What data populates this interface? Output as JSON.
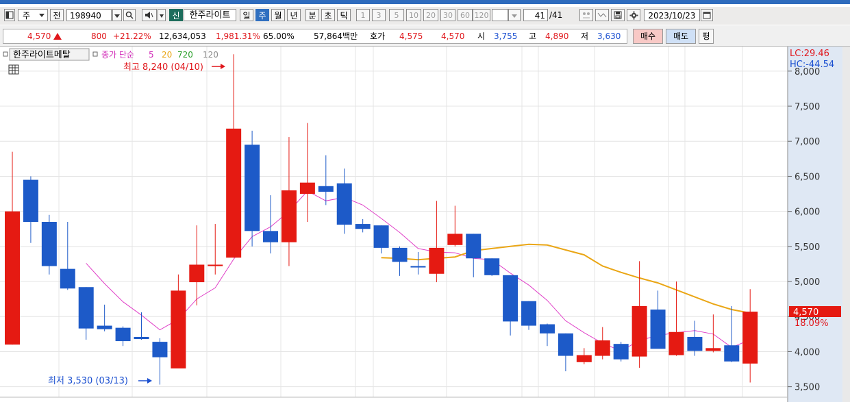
{
  "toolbar": {
    "market": "주",
    "prev_label": "전",
    "code": "198940",
    "sin_badge": "신",
    "name": "한주라이트",
    "periods": [
      "일",
      "주",
      "월",
      "년",
      "분",
      "초",
      "틱"
    ],
    "selected_period": "주",
    "intervals": [
      "1",
      "3",
      "5",
      "10",
      "20",
      "30",
      "60",
      "120"
    ],
    "count": "41",
    "count_total": "/41",
    "date": "2023/10/23"
  },
  "quote": {
    "price": "4,570",
    "change": "800",
    "change_pct": "+21.22%",
    "volume": "12,634,053",
    "volume_pct": "1,981.31%",
    "turnover": "65.00%",
    "amount": "57,864백만",
    "hoga_label": "호가",
    "ask": "4,575",
    "bid": "4,570",
    "open_label": "시",
    "open": "3,755",
    "high_label": "고",
    "high": "4,890",
    "low_label": "저",
    "low": "3,630",
    "buy_button": "매수",
    "sell_button": "매도",
    "eval_button": "평"
  },
  "chart_header": {
    "title": "한주라이트메탈",
    "ma_label": "종가 단순",
    "ma_periods": [
      "5",
      "20",
      "720",
      "120"
    ],
    "lc": "LC:29.46",
    "hc": "HC:-44.54",
    "max_note": "최고 8,240 (04/10)",
    "min_note": "최저 3,530 (03/13)",
    "last_price_tag": "4,570",
    "last_pct_tag": "18.09%"
  },
  "colors": {
    "up": "#e51a12",
    "down": "#1d5ac8",
    "ma5": "#e040c8",
    "ma20": "#eaa615",
    "axis_bg": "#dfe8f4"
  },
  "chart_data": {
    "type": "candlestick",
    "ylim": [
      3350,
      8350
    ],
    "y_ticks": [
      3500,
      4000,
      4500,
      5000,
      5500,
      6000,
      6500,
      7000,
      7500,
      8000
    ],
    "y_tick_labels": [
      "3,500",
      "4,000",
      "4,500",
      "5,000",
      "5,500",
      "6,000",
      "6,500",
      "7,000",
      "7,500",
      "8,000"
    ],
    "candles": [
      {
        "o": 4100,
        "h": 6850,
        "l": 4100,
        "c": 6000
      },
      {
        "o": 6450,
        "h": 6500,
        "l": 5550,
        "c": 5850
      },
      {
        "o": 5850,
        "h": 5950,
        "l": 5100,
        "c": 5220
      },
      {
        "o": 5180,
        "h": 5850,
        "l": 4880,
        "c": 4900
      },
      {
        "o": 4920,
        "h": 4920,
        "l": 4170,
        "c": 4330
      },
      {
        "o": 4370,
        "h": 4670,
        "l": 4290,
        "c": 4320
      },
      {
        "o": 4340,
        "h": 4360,
        "l": 4080,
        "c": 4150
      },
      {
        "o": 4210,
        "h": 4560,
        "l": 4170,
        "c": 4180
      },
      {
        "o": 4140,
        "h": 4190,
        "l": 3530,
        "c": 3920
      },
      {
        "o": 3760,
        "h": 5100,
        "l": 3760,
        "c": 4870
      },
      {
        "o": 4990,
        "h": 5800,
        "l": 4660,
        "c": 5240
      },
      {
        "o": 5220,
        "h": 5820,
        "l": 5100,
        "c": 5240
      },
      {
        "o": 5340,
        "h": 8240,
        "l": 5340,
        "c": 7180
      },
      {
        "o": 6950,
        "h": 7150,
        "l": 5500,
        "c": 5720
      },
      {
        "o": 5720,
        "h": 6230,
        "l": 5400,
        "c": 5560
      },
      {
        "o": 5560,
        "h": 7060,
        "l": 5220,
        "c": 6300
      },
      {
        "o": 6250,
        "h": 7260,
        "l": 5850,
        "c": 6410
      },
      {
        "o": 6360,
        "h": 6800,
        "l": 6090,
        "c": 6280
      },
      {
        "o": 6400,
        "h": 6610,
        "l": 5680,
        "c": 5810
      },
      {
        "o": 5820,
        "h": 5890,
        "l": 5700,
        "c": 5750
      },
      {
        "o": 5800,
        "h": 5800,
        "l": 5400,
        "c": 5480
      },
      {
        "o": 5480,
        "h": 5500,
        "l": 5080,
        "c": 5280
      },
      {
        "o": 5220,
        "h": 5420,
        "l": 5100,
        "c": 5200
      },
      {
        "o": 5110,
        "h": 6150,
        "l": 4990,
        "c": 5480
      },
      {
        "o": 5520,
        "h": 6080,
        "l": 5500,
        "c": 5680
      },
      {
        "o": 5680,
        "h": 5680,
        "l": 5060,
        "c": 5330
      },
      {
        "o": 5330,
        "h": 5330,
        "l": 5080,
        "c": 5090
      },
      {
        "o": 5090,
        "h": 5090,
        "l": 4230,
        "c": 4430
      },
      {
        "o": 4720,
        "h": 4720,
        "l": 4310,
        "c": 4370
      },
      {
        "o": 4390,
        "h": 4400,
        "l": 4080,
        "c": 4260
      },
      {
        "o": 4260,
        "h": 4260,
        "l": 3720,
        "c": 3940
      },
      {
        "o": 3850,
        "h": 4050,
        "l": 3820,
        "c": 3950
      },
      {
        "o": 3940,
        "h": 4350,
        "l": 3890,
        "c": 4160
      },
      {
        "o": 4110,
        "h": 4140,
        "l": 3860,
        "c": 3890
      },
      {
        "o": 3930,
        "h": 5290,
        "l": 3770,
        "c": 4650
      },
      {
        "o": 4600,
        "h": 4870,
        "l": 4050,
        "c": 4040
      },
      {
        "o": 3950,
        "h": 5000,
        "l": 3940,
        "c": 4280
      },
      {
        "o": 4210,
        "h": 4440,
        "l": 3940,
        "c": 4010
      },
      {
        "o": 4010,
        "h": 4530,
        "l": 3990,
        "c": 4050
      },
      {
        "o": 4090,
        "h": 4650,
        "l": 3850,
        "c": 3860
      },
      {
        "o": 3830,
        "h": 4890,
        "l": 3560,
        "c": 4570
      }
    ],
    "series": [
      {
        "name": "5",
        "values": [
          null,
          null,
          null,
          null,
          5260,
          4970,
          4710,
          4520,
          4310,
          4460,
          4750,
          4910,
          5320,
          5640,
          5780,
          6000,
          6290,
          6150,
          6200,
          6090,
          5900,
          5700,
          5470,
          5420,
          5410,
          5330,
          5310,
          5120,
          4950,
          4730,
          4440,
          4270,
          4120,
          4010,
          4160,
          4230,
          4270,
          4300,
          4250,
          4060,
          4170
        ]
      },
      {
        "name": "20",
        "values": [
          null,
          null,
          null,
          null,
          null,
          null,
          null,
          null,
          null,
          null,
          null,
          null,
          null,
          null,
          null,
          null,
          null,
          null,
          null,
          null,
          5340,
          5330,
          5310,
          5330,
          5350,
          5440,
          5470,
          5500,
          5530,
          5520,
          5450,
          5380,
          5220,
          5130,
          5050,
          4980,
          4880,
          4780,
          4680,
          4600,
          4550
        ]
      }
    ]
  }
}
